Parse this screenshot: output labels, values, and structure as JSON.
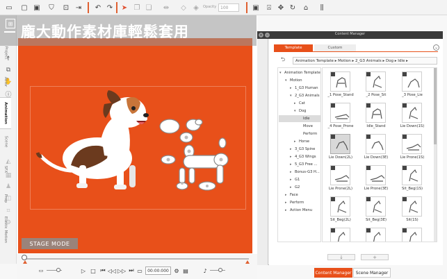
{
  "toolbar": {
    "opacity_label": "Opacity",
    "opacity_value": "100"
  },
  "banner": {
    "title": "龐大動作素材庫輕鬆套用"
  },
  "stage": {
    "mode_label": "STAGE MODE"
  },
  "playback": {
    "time": "00:00:000"
  },
  "content_manager": {
    "window_title": "Content Manager",
    "side_tabs": [
      "Project",
      "Actor",
      "Animation",
      "Scene",
      "SFX",
      "Prop",
      "Elastic Motion"
    ],
    "active_side_tab": "Animation",
    "tabs": {
      "template": "Template",
      "custom": "Custom"
    },
    "breadcrumb": "Animation Template ▸ Motion ▸ 2_G3 Animals ▸ Dog ▸ Idle ▸",
    "tree": [
      {
        "label": "Animation Template",
        "arrow": "▾"
      },
      {
        "label": "Motion",
        "arrow": "▾"
      },
      {
        "label": "1_G3 Human",
        "arrow": "▸"
      },
      {
        "label": "2_G3 Animals",
        "arrow": "▾"
      },
      {
        "label": "Cat",
        "arrow": "▸"
      },
      {
        "label": "Dog",
        "arrow": "▾"
      },
      {
        "label": "Idle",
        "arrow": ""
      },
      {
        "label": "Move",
        "arrow": ""
      },
      {
        "label": "Perform",
        "arrow": ""
      },
      {
        "label": "Horse",
        "arrow": "▸"
      },
      {
        "label": "3_G3 Spine",
        "arrow": "▸"
      },
      {
        "label": "4_G3 Wings",
        "arrow": "▸"
      },
      {
        "label": "5_G3 Free ...",
        "arrow": "▸"
      },
      {
        "label": "Bonus-G3 H...",
        "arrow": "▸"
      },
      {
        "label": "G1",
        "arrow": "▸"
      },
      {
        "label": "G2",
        "arrow": "▸"
      },
      {
        "label": "Face",
        "arrow": "▸"
      },
      {
        "label": "Perform",
        "arrow": "▸"
      },
      {
        "label": "Action Menu",
        "arrow": "▸"
      }
    ],
    "items": [
      "_1 Pose_Stand",
      "_2 Pose_Sit",
      "_3 Pose_Lie",
      "_4 Pose_Prone",
      "Idle_Stand",
      "Lie Down(1S)",
      "Lie Down(2L)",
      "Lie Down(3E)",
      "Lie Prone(1S)",
      "Lie Prone(2L)",
      "Lie Prone(3E)",
      "Sit_Beg(1S)",
      "Sit_Beg(2L)",
      "Sit_Beg(3E)",
      "Sit(1S)",
      "",
      "",
      ""
    ],
    "footer": {
      "download_icon": "↓",
      "add_icon": "+"
    }
  },
  "bottom_tabs": {
    "content_manager": "Content Manager",
    "scene_manager": "Scene Manager"
  },
  "colors": {
    "accent": "#e8501a",
    "stage_bg": "#e8501a"
  }
}
